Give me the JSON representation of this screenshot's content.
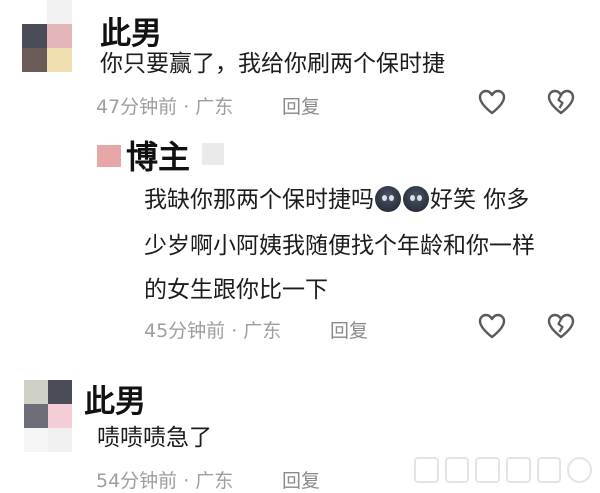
{
  "comments": [
    {
      "name": "此男",
      "text": "你只要赢了，我给你刷两个保时捷",
      "time": "47分钟前",
      "location": "广东",
      "reply_label": "回复"
    },
    {
      "name": "博主",
      "text_line1_a": "我缺你那两个保时捷吗",
      "text_line1_b": "好笑 你多",
      "text_line2": "少岁啊小阿姨我随便找个年龄和你一样",
      "text_line3": "的女生跟你比一下",
      "time": "45分钟前",
      "location": "广东",
      "reply_label": "回复"
    },
    {
      "name": "此男",
      "text": "啧啧啧急了",
      "time": "54分钟前",
      "location": "广东",
      "reply_label": "回复"
    }
  ],
  "separator": "·",
  "icons": [
    "like-heart-icon",
    "dislike-broken-heart-icon"
  ],
  "colors": {
    "text": "#1c1c1c",
    "meta": "#9e9e9e",
    "icon": "#5a5a5a"
  }
}
